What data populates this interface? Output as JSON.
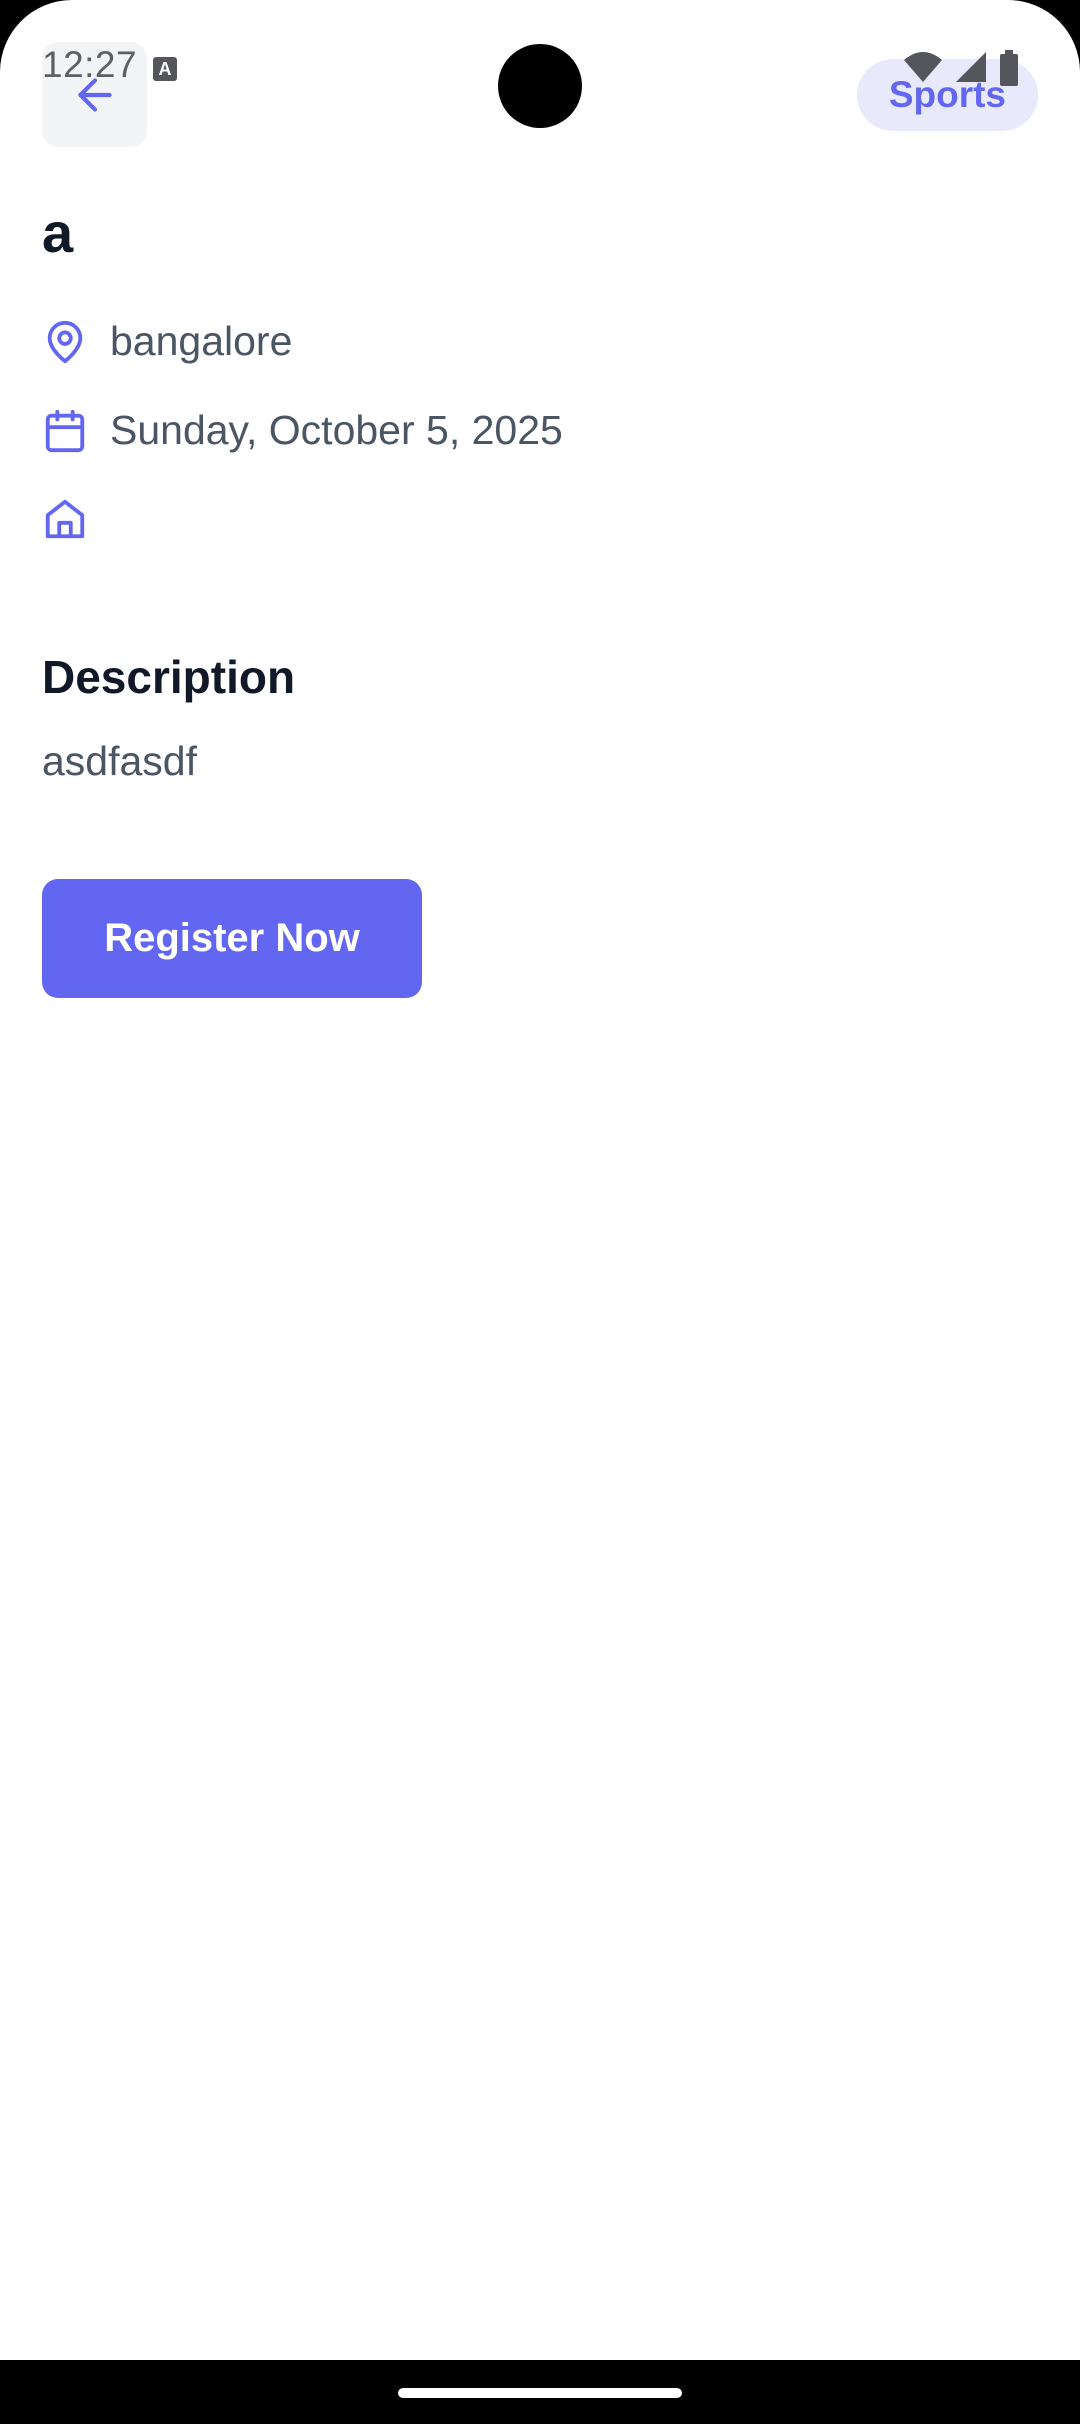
{
  "status_bar": {
    "time": "12:27",
    "notification_glyph": "A"
  },
  "header": {
    "back_icon": "arrow-left-icon",
    "category": "Sports"
  },
  "event": {
    "title": "a",
    "location": "bangalore",
    "date": "Sunday, October 5, 2025",
    "venue": ""
  },
  "description": {
    "heading": "Description",
    "text": "asdfasdf"
  },
  "actions": {
    "register_label": "Register Now"
  },
  "colors": {
    "accent": "#6366f1",
    "accent_light": "#e8eafc",
    "heading": "#111827",
    "body_text": "#4b5563"
  },
  "icons": [
    "arrow-left-icon",
    "map-pin-icon",
    "calendar-icon",
    "home-icon",
    "wifi-icon",
    "signal-icon",
    "battery-icon"
  ]
}
